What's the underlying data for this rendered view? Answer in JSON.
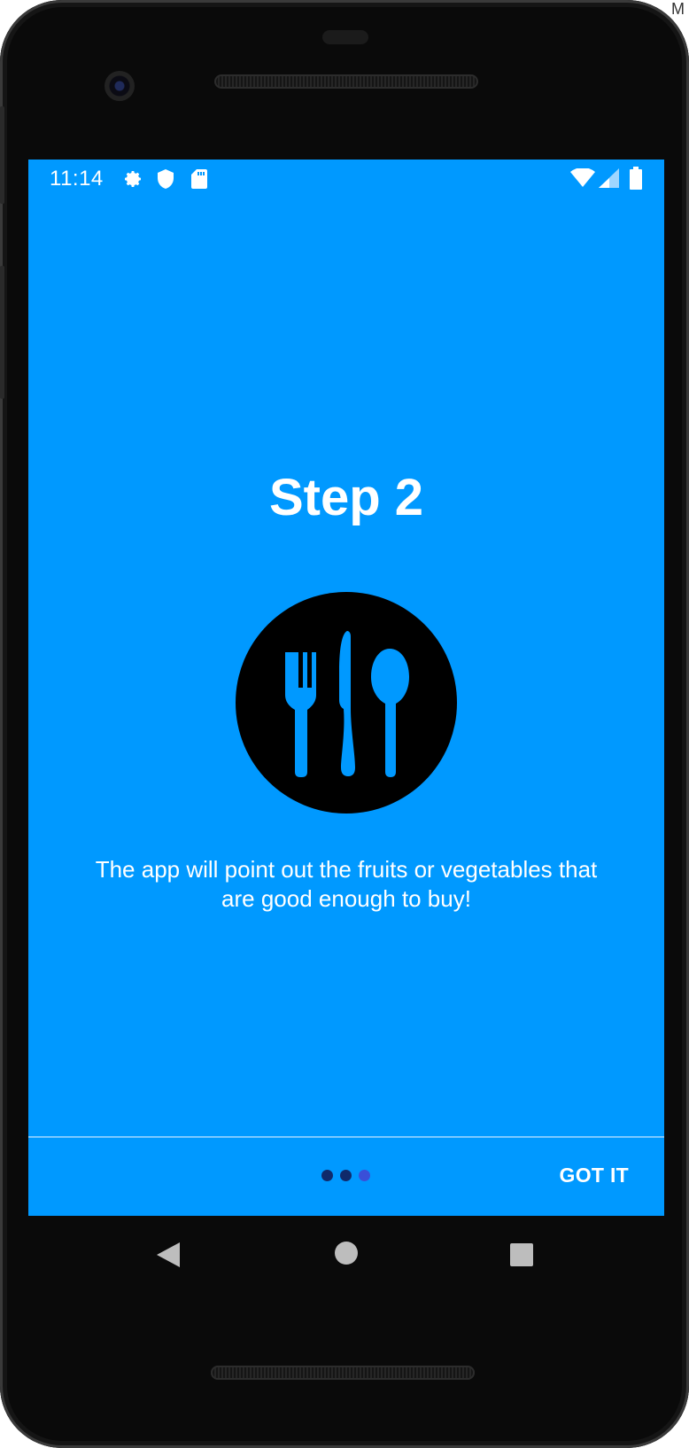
{
  "status_bar": {
    "time": "11:14",
    "left_icons": [
      "gear-icon",
      "shield-icon",
      "sd-card-icon"
    ],
    "right_icons": [
      "wifi-icon",
      "signal-icon",
      "battery-icon"
    ]
  },
  "onboarding": {
    "title": "Step 2",
    "illustration": "cutlery-icon",
    "description": "The app will point out the fruits or vegetables that are good enough to buy!",
    "page_indicator": {
      "total": 3,
      "current": 3
    },
    "got_it_label": "GOT IT"
  },
  "nav_bar": {
    "buttons": [
      "back-icon",
      "home-icon",
      "recents-icon"
    ]
  },
  "colors": {
    "screen_bg": "#0099ff",
    "text": "#ffffff",
    "dot_inactive": "#102a6b",
    "dot_active": "#3a4fd8",
    "phone_body": "#0a0a0a"
  },
  "corner_text": "M"
}
